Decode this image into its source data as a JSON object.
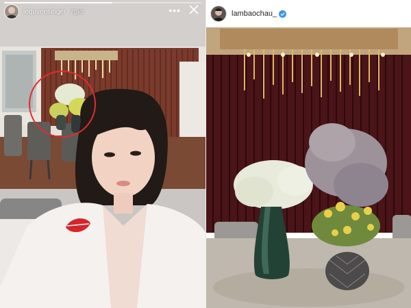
{
  "story": {
    "username": "lequyensinger",
    "time": "7giờ",
    "progress": 0.55,
    "more_icon": "more-horizontal-icon",
    "close_icon": "close-icon",
    "highlight_color": "#e32c2c"
  },
  "post": {
    "username": "lambaochau_",
    "verified": true,
    "verified_icon": "verified-badge-icon",
    "badge_color": "#3897f0"
  }
}
